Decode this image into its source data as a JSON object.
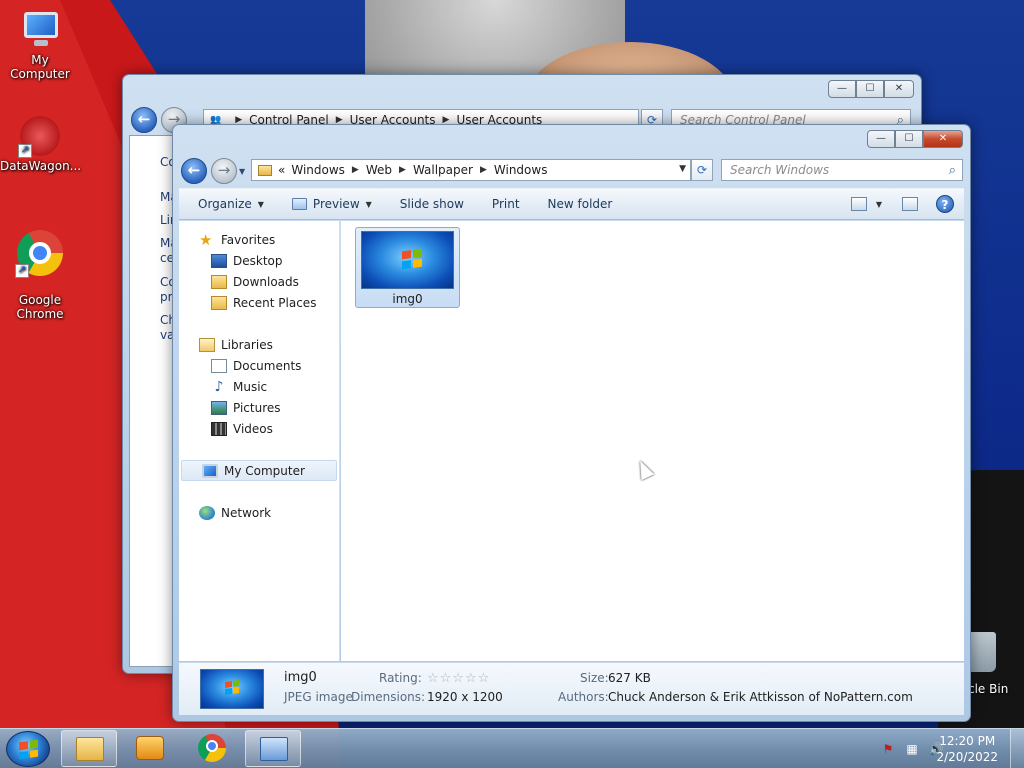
{
  "desktop": {
    "icons": [
      {
        "label": "My Computer"
      },
      {
        "label": "DataWagon..."
      },
      {
        "label": "Google\nChrome"
      }
    ],
    "recycle_bin_label": "cle Bin"
  },
  "control_panel_window": {
    "address": {
      "segments": [
        "Control Panel",
        "User Accounts",
        "User Accounts"
      ]
    },
    "search_placeholder": "Search Control Panel",
    "caption_buttons": {
      "minimize": "—",
      "maximize": "☐",
      "close": "✕"
    },
    "visible_text_fragments": [
      "Co",
      "Ma",
      "Lin",
      "Ma",
      "ce",
      "Co",
      "pre",
      "Ch",
      "va"
    ]
  },
  "explorer_window": {
    "address": {
      "prefix": "«",
      "segments": [
        "Windows",
        "Web",
        "Wallpaper",
        "Windows"
      ]
    },
    "search_placeholder": "Search Windows",
    "caption_buttons": {
      "minimize": "—",
      "maximize": "☐",
      "close": "✕"
    },
    "toolbar": {
      "organize": "Organize",
      "preview": "Preview",
      "slideshow": "Slide show",
      "print": "Print",
      "new_folder": "New folder",
      "help": "?"
    },
    "nav": {
      "favorites": "Favorites",
      "desktop": "Desktop",
      "downloads": "Downloads",
      "recent": "Recent Places",
      "libraries": "Libraries",
      "documents": "Documents",
      "music": "Music",
      "pictures": "Pictures",
      "videos": "Videos",
      "my_computer": "My Computer",
      "network": "Network"
    },
    "files": [
      {
        "name": "img0",
        "selected": true
      }
    ],
    "details": {
      "name": "img0",
      "type": "JPEG image",
      "rating_label": "Rating:",
      "rating_stars": "☆☆☆☆☆",
      "dimensions_label": "Dimensions:",
      "dimensions_value": "1920 x 1200",
      "size_label": "Size:",
      "size_value": "627 KB",
      "authors_label": "Authors:",
      "authors_value": "Chuck Anderson & Erik Attkisson of NoPattern.com"
    }
  },
  "taskbar": {
    "clock_time": "12:20 PM",
    "clock_date": "2/20/2022",
    "pinned": [
      "windows-explorer",
      "media-player",
      "google-chrome",
      "control-panel"
    ]
  },
  "colors": {
    "accent": "#2a64c0",
    "selection": "#c7dcf4",
    "close_button": "#c74a2d",
    "wallpaper_red": "#c9181a",
    "wallpaper_blue": "#0d2a8a"
  }
}
